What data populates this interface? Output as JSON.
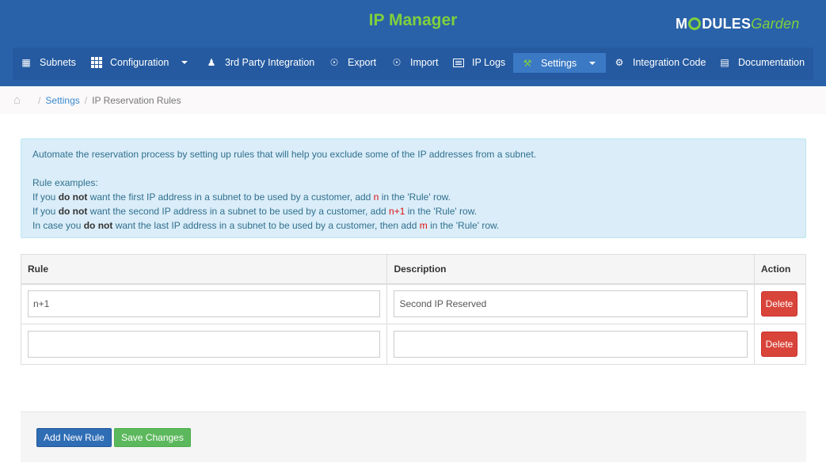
{
  "header": {
    "title": "IP Manager",
    "logo": {
      "part1": "M",
      "part2": "DULES",
      "part3": "Garden"
    }
  },
  "nav": {
    "items": [
      {
        "label": "Subnets",
        "icon": "briefcase-icon"
      },
      {
        "label": "Configuration",
        "icon": "grid-icon",
        "dropdown": true
      },
      {
        "label": "3rd Party Integration",
        "icon": "users-icon"
      },
      {
        "label": "Export",
        "icon": "export-icon"
      },
      {
        "label": "Import",
        "icon": "import-icon"
      },
      {
        "label": "IP Logs",
        "icon": "list-icon"
      },
      {
        "label": "Settings",
        "icon": "wrench-icon",
        "dropdown": true,
        "active": true
      },
      {
        "label": "Integration Code",
        "icon": "gears-icon"
      },
      {
        "label": "Documentation",
        "icon": "book-icon"
      }
    ]
  },
  "breadcrumb": {
    "home_icon": "home-icon",
    "link": "Settings",
    "current": "IP Reservation Rules"
  },
  "info": {
    "intro": "Automate the reservation process by setting up rules that will help you exclude some of the IP addresses from a subnet.",
    "examples_title": "Rule examples:",
    "line1": {
      "pre": "If you ",
      "bold": "do not",
      "mid": " want the first IP address in a subnet to be used by a customer, add ",
      "code": "n",
      "post": " in the 'Rule' row."
    },
    "line2": {
      "pre": "If you ",
      "bold": "do not",
      "mid": " want the second IP address in a subnet to be used by a customer, add ",
      "code": "n+1",
      "post": " in the 'Rule' row."
    },
    "line3": {
      "pre": "In case you ",
      "bold": "do not",
      "mid": " want the last IP address in a subnet to be used by a customer, then add ",
      "code": "m",
      "post": " in the 'Rule' row."
    }
  },
  "table": {
    "headers": {
      "rule": "Rule",
      "description": "Description",
      "action": "Action"
    },
    "rows": [
      {
        "rule": "n+1",
        "description": "Second IP Reserved",
        "action": "Delete"
      },
      {
        "rule": "",
        "description": "",
        "action": "Delete"
      }
    ]
  },
  "buttons": {
    "add": "Add New Rule",
    "save": "Save Changes"
  },
  "colors": {
    "header_bg": "#2a62a9",
    "title": "#7fd03c",
    "delete": "#d9443a",
    "add": "#2f6db5",
    "save": "#5cb85c"
  }
}
